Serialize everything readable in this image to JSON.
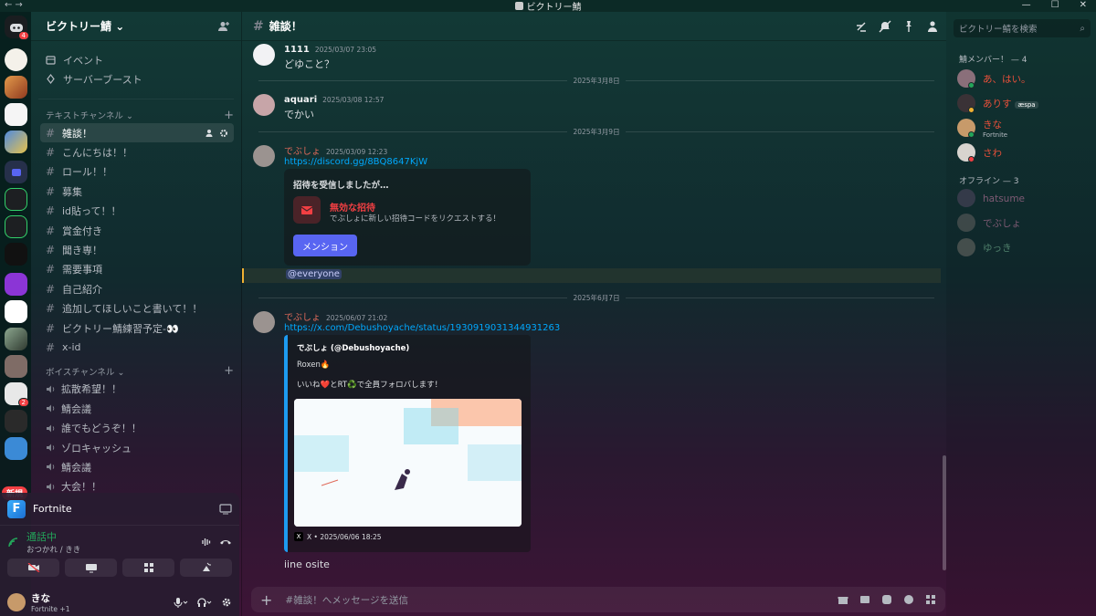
{
  "window": {
    "title": "ビクトリー鯖"
  },
  "servers": {
    "home_badge": "4",
    "badge_2": "2",
    "new_label": "新規"
  },
  "guild": {
    "name": "ビクトリー鯖"
  },
  "nav": {
    "events": "イベント",
    "boost": "サーバーブースト"
  },
  "text_category": "テキストチャンネル",
  "text_channels": [
    "雑談！",
    "こんにちは！！",
    "ロール！！",
    "募集",
    "id貼って！！",
    "賞金付き",
    "聞き専！",
    "需要事項",
    "自己紹介",
    "追加してほしいこと書いて！！",
    "ビクトリー鯖練習予定-👀",
    "x-id"
  ],
  "voice_category": "ボイスチャンネル",
  "voice_channels": [
    "拡散希望！！",
    "鯖会議",
    "誰でもどうぞ！！",
    "ゾロキャッシュ",
    "鯖会議",
    "大会！！"
  ],
  "voice_panel": {
    "game": "Fortnite",
    "status": "通話中",
    "channel": "おつかれ / きき"
  },
  "user": {
    "name": "きな",
    "activity": "Fortnite +1",
    "avatar_color": "#c79a6a"
  },
  "channel": {
    "title": "雑談！"
  },
  "messages": {
    "m1": {
      "author": "1111",
      "timestamp": "2025/03/07 23:05",
      "text": "どゆこと？"
    },
    "div1": "2025年3月8日",
    "m2": {
      "author": "aquari",
      "timestamp": "2025/03/08 12:57",
      "text": "でかい"
    },
    "div2": "2025年3月9日",
    "m3": {
      "author": "でぶしょ",
      "timestamp": "2025/03/09 12:23",
      "link": "https://discord.gg/8BQ8647KjW"
    },
    "invite": {
      "heading": "招待を受信しましたが…",
      "title": "無効な招待",
      "subtitle": "でぶしょに新しい招待コードをリクエストする！",
      "button": "メンション"
    },
    "mention": "@everyone",
    "div3": "2025年6月7日",
    "m4": {
      "author": "でぶしょ",
      "timestamp": "2025/06/07 21:02",
      "link": "https://x.com/Debushoyache/status/1930919031344931263"
    },
    "embed": {
      "author": "でぶしょ (@Debushoyache)",
      "line1": "Roxen🔥",
      "line2": "いいね❤️とRT♻️で全員フォロバします！",
      "footer": "X • 2025/06/06 18:25"
    },
    "after": "iine osite"
  },
  "composer": {
    "placeholder": "#雑談！へメッセージを送信"
  },
  "members": {
    "search_placeholder": "ビクトリー鯖を検索",
    "online_header": "鯖メンバー！ — 4",
    "online": [
      {
        "name": "あ、はい。",
        "color": "#e8503a",
        "status": "#23a55a",
        "avatar": "#8a6f7a"
      },
      {
        "name": "ありす",
        "color": "#e8503a",
        "tag": "æspa",
        "status": "#f0b132",
        "avatar": "#3a3236"
      },
      {
        "name": "きな",
        "color": "#e8503a",
        "activity": "Fortnite",
        "status": "#23a55a",
        "avatar": "#c79a6a"
      },
      {
        "name": "さわ",
        "color": "#e8503a",
        "status": "#f23f43",
        "avatar": "#d8d4cf"
      }
    ],
    "offline_header": "オフライン — 3",
    "offline": [
      {
        "name": "hatsume",
        "color": "#7d5a73",
        "avatar": "#5a4a66"
      },
      {
        "name": "でぶしょ",
        "color": "#7d5a73",
        "avatar": "#6b6766"
      },
      {
        "name": "ゆっき",
        "color": "#4e7e6a",
        "avatar": "#7a736d"
      }
    ]
  }
}
